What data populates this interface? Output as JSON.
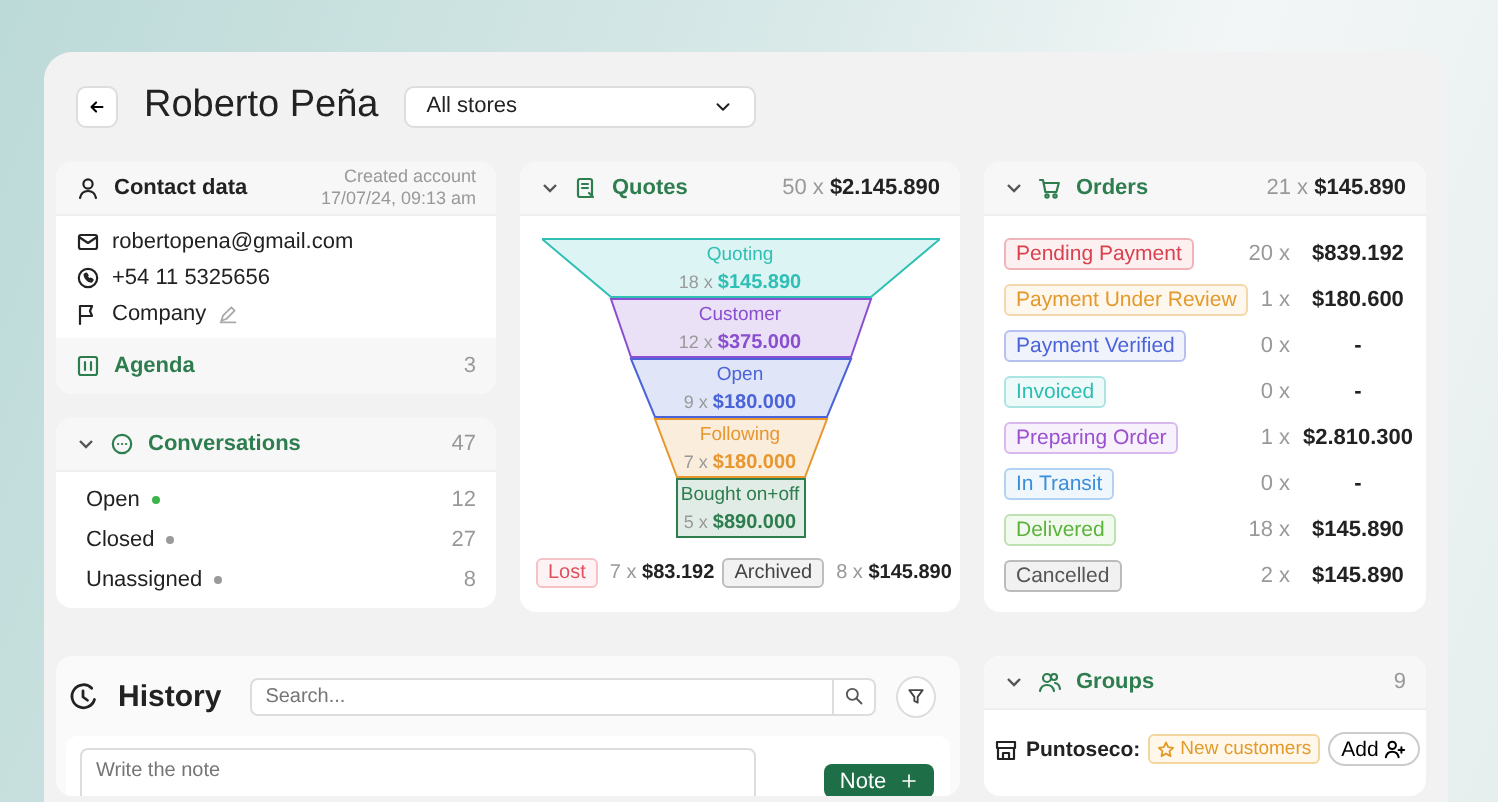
{
  "header": {
    "title": "Roberto Peña",
    "store_select": {
      "value": "All stores"
    }
  },
  "contact": {
    "title": "Contact data",
    "created_label": "Created account",
    "created_date": "17/07/24, 09:13 am",
    "email": "robertopena@gmail.com",
    "phone": "+54 11 5325656",
    "company": "Company",
    "agenda": {
      "label": "Agenda",
      "count": "3"
    }
  },
  "conversations": {
    "title": "Conversations",
    "count": "47",
    "expanded": true,
    "items": [
      {
        "label": "Open",
        "count": "12",
        "color": "#3bb54a"
      },
      {
        "label": "Closed",
        "count": "27",
        "color": "#9a9a9a"
      },
      {
        "label": "Unassigned",
        "count": "8",
        "color": "#9a9a9a"
      }
    ]
  },
  "quotes": {
    "title": "Quotes",
    "count": "50 x",
    "total": "$2.145.890",
    "expanded": true,
    "stages": [
      {
        "label": "Quoting",
        "count": "18 x",
        "amount": "$145.890",
        "color": "#2fbfb5",
        "kind": "trapezoid"
      },
      {
        "label": "Customer",
        "count": "12 x",
        "amount": "$375.000",
        "color": "#8a4fd0",
        "kind": "trapezoid"
      },
      {
        "label": "Open",
        "count": "9 x",
        "amount": "$180.000",
        "color": "#4a63d8",
        "kind": "trapezoid"
      },
      {
        "label": "Following",
        "count": "7 x",
        "amount": "$180.000",
        "color": "#e8962e",
        "kind": "trapezoid"
      },
      {
        "label": "Bought on+off",
        "count": "5 x",
        "amount": "$890.000",
        "color": "#2e7d4f",
        "kind": "box"
      }
    ],
    "outcomes": [
      {
        "label": "Lost",
        "count": "7 x",
        "amount": "$83.192",
        "color": "#e0505e"
      },
      {
        "label": "Archived",
        "count": "8 x",
        "amount": "$145.890",
        "color": "#444444"
      }
    ]
  },
  "orders": {
    "title": "Orders",
    "count": "21 x",
    "total": "$145.890",
    "expanded": true,
    "items": [
      {
        "label": "Pending Payment",
        "count": "20 x",
        "amount": "$839.192",
        "color": "#d9414f"
      },
      {
        "label": "Payment Under Review",
        "count": "1 x",
        "amount": "$180.600",
        "color": "#e39a2b"
      },
      {
        "label": "Payment Verified",
        "count": "0 x",
        "amount": "-",
        "color": "#4a63d8"
      },
      {
        "label": "Invoiced",
        "count": "0 x",
        "amount": "-",
        "color": "#2cbdb4"
      },
      {
        "label": "Preparing Order",
        "count": "1 x",
        "amount": "$2.810.300",
        "color": "#9b4fd1"
      },
      {
        "label": "In Transit",
        "count": "0 x",
        "amount": "-",
        "color": "#3b8fd9"
      },
      {
        "label": "Delivered",
        "count": "18 x",
        "amount": "$145.890",
        "color": "#5cb33c"
      },
      {
        "label": "Cancelled",
        "count": "2 x",
        "amount": "$145.890",
        "color": "#555555"
      }
    ]
  },
  "history": {
    "title": "History",
    "search": {
      "placeholder": "Search..."
    },
    "note": {
      "placeholder": "Write the note"
    },
    "note_button": "Note"
  },
  "groups": {
    "title": "Groups",
    "count": "9",
    "expanded": true,
    "store": "Puntoseco:",
    "tag": "New customers",
    "add_button": "Add"
  }
}
